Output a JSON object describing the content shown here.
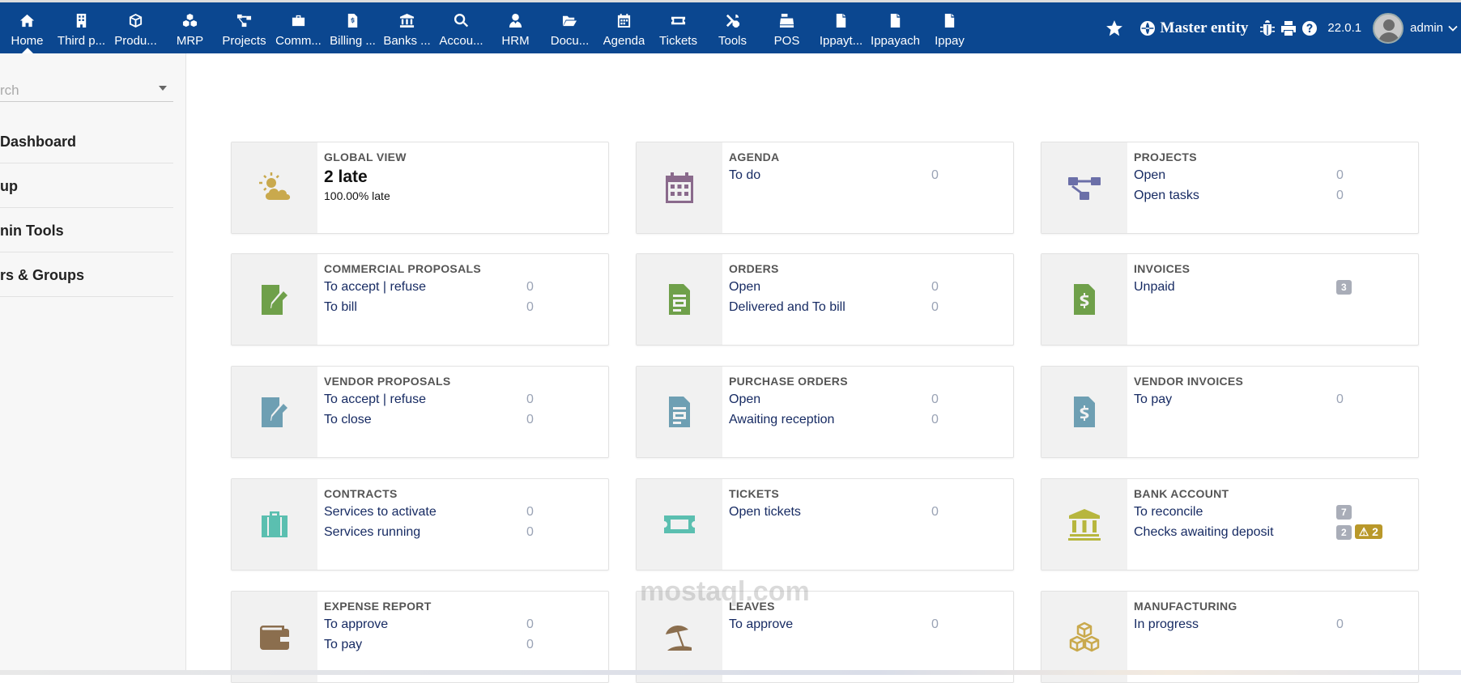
{
  "menu": [
    {
      "label": "Home",
      "icon": "home-icon"
    },
    {
      "label": "Third p...",
      "icon": "building-icon"
    },
    {
      "label": "Produ...",
      "icon": "cube-icon"
    },
    {
      "label": "MRP",
      "icon": "cubes-icon"
    },
    {
      "label": "Projects",
      "icon": "project-diagram-icon"
    },
    {
      "label": "Comm...",
      "icon": "suitcase-icon"
    },
    {
      "label": "Billing ...",
      "icon": "file-invoice-icon"
    },
    {
      "label": "Banks ...",
      "icon": "bank-icon"
    },
    {
      "label": "Accou...",
      "icon": "search-dollar-icon"
    },
    {
      "label": "HRM",
      "icon": "user-tie-icon"
    },
    {
      "label": "Docu...",
      "icon": "folder-open-icon"
    },
    {
      "label": "Agenda",
      "icon": "calendar-icon"
    },
    {
      "label": "Tickets",
      "icon": "ticket-icon"
    },
    {
      "label": "Tools",
      "icon": "tools-icon"
    },
    {
      "label": "POS",
      "icon": "cash-register-icon"
    },
    {
      "label": "Ippayt...",
      "icon": "file-icon"
    },
    {
      "label": "Ippayach",
      "icon": "file-icon"
    },
    {
      "label": "Ippay",
      "icon": "file-icon"
    }
  ],
  "topright": {
    "entity": "Master entity",
    "version": "22.0.1",
    "user": "admin"
  },
  "sidebar": {
    "search_text": "rch",
    "links": [
      "Dashboard",
      "up",
      "nin Tools",
      "rs & Groups"
    ]
  },
  "boxes": {
    "global": {
      "title": "GLOBAL VIEW",
      "big": "2 late",
      "small": "100.00% late"
    },
    "agenda": {
      "title": "AGENDA",
      "lines": [
        {
          "label": "To do",
          "value": "0"
        }
      ]
    },
    "projects": {
      "title": "PROJECTS",
      "lines": [
        {
          "label": "Open",
          "value": "0"
        },
        {
          "label": "Open tasks",
          "value": "0"
        }
      ]
    },
    "commercial": {
      "title": "COMMERCIAL PROPOSALS",
      "lines": [
        {
          "label": "To accept | refuse",
          "value": "0"
        },
        {
          "label": "To bill",
          "value": "0"
        }
      ]
    },
    "orders": {
      "title": "ORDERS",
      "lines": [
        {
          "label": "Open",
          "value": "0"
        },
        {
          "label": "Delivered and To bill",
          "value": "0"
        }
      ]
    },
    "invoices": {
      "title": "INVOICES",
      "lines": [
        {
          "label": "Unpaid",
          "value": "3"
        }
      ]
    },
    "vendorprop": {
      "title": "VENDOR PROPOSALS",
      "lines": [
        {
          "label": "To accept | refuse",
          "value": "0"
        },
        {
          "label": "To close",
          "value": "0"
        }
      ]
    },
    "purchase": {
      "title": "PURCHASE ORDERS",
      "lines": [
        {
          "label": "Open",
          "value": "0"
        },
        {
          "label": "Awaiting reception",
          "value": "0"
        }
      ]
    },
    "vendorinv": {
      "title": "VENDOR INVOICES",
      "lines": [
        {
          "label": "To pay",
          "value": "0"
        }
      ]
    },
    "contracts": {
      "title": "CONTRACTS",
      "lines": [
        {
          "label": "Services to activate",
          "value": "0"
        },
        {
          "label": "Services running",
          "value": "0"
        }
      ]
    },
    "tickets": {
      "title": "TICKETS",
      "lines": [
        {
          "label": "Open tickets",
          "value": "0"
        }
      ]
    },
    "bank": {
      "title": "BANK ACCOUNT",
      "lines": [
        {
          "label": "To reconcile",
          "value": "7"
        },
        {
          "label": "Checks awaiting deposit",
          "value": "2",
          "warn": "2"
        }
      ]
    },
    "expense": {
      "title": "EXPENSE REPORT",
      "lines": [
        {
          "label": "To approve",
          "value": "0"
        },
        {
          "label": "To pay",
          "value": "0"
        }
      ]
    },
    "leaves": {
      "title": "LEAVES",
      "lines": [
        {
          "label": "To approve",
          "value": "0"
        }
      ]
    },
    "manufacturing": {
      "title": "MANUFACTURING",
      "lines": [
        {
          "label": "In progress",
          "value": "0"
        }
      ]
    }
  },
  "watermark": "mostaql.com",
  "colors": {
    "topbar": "#0b4790",
    "link": "#172b63",
    "muted": "#9aa3b5"
  }
}
